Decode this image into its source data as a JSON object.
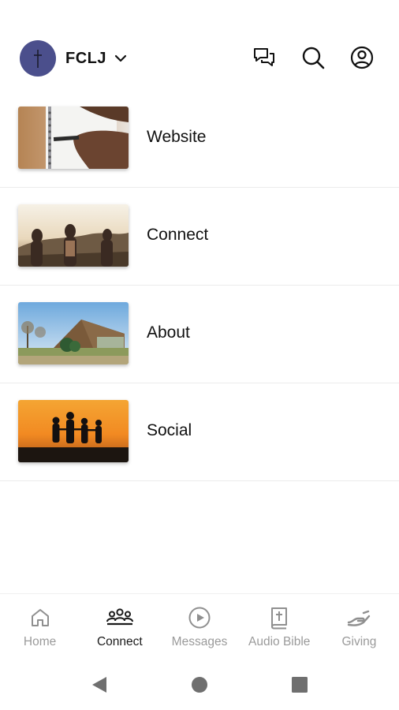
{
  "header": {
    "org_name": "FCLJ",
    "avatar_color": "#4b4f8c",
    "icons": [
      "chevron-down-icon",
      "chat-icon",
      "search-icon",
      "account-icon"
    ]
  },
  "list": {
    "items": [
      {
        "label": "Website",
        "image": "notebook-writing-photo"
      },
      {
        "label": "Connect",
        "image": "friends-sunset-photo"
      },
      {
        "label": "About",
        "image": "church-building-photo"
      },
      {
        "label": "Social",
        "image": "family-silhouette-sunset-photo"
      }
    ]
  },
  "bottom_nav": {
    "active": "Connect",
    "active_color": "#1a1a1a",
    "inactive_color": "#9a9a9a",
    "items": [
      {
        "label": "Home",
        "icon": "home-icon"
      },
      {
        "label": "Connect",
        "icon": "people-group-icon"
      },
      {
        "label": "Messages",
        "icon": "play-circle-icon"
      },
      {
        "label": "Audio Bible",
        "icon": "bible-icon"
      },
      {
        "label": "Giving",
        "icon": "giving-hand-icon"
      }
    ]
  },
  "system_nav": {
    "icons": [
      "back-icon",
      "home-circle-icon",
      "recents-icon"
    ]
  }
}
